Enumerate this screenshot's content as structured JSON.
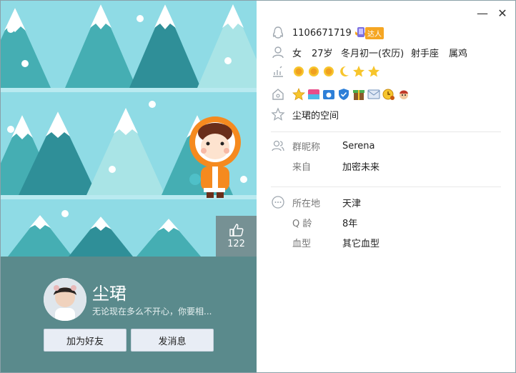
{
  "profile": {
    "qq_number": "1106671719",
    "gender": "女",
    "age": "27岁",
    "birthday": "冬月初一(农历)",
    "constellation": "射手座",
    "zodiac": "属鸡",
    "badge_label": "达人",
    "space_link": "尘珺的空间",
    "nickname": "尘珺",
    "signature": "无论现在多么不开心，你要相..."
  },
  "group_info": {
    "nick_label": "群昵称",
    "nick_value": "Serena",
    "from_label": "来自",
    "from_value": "加密未来"
  },
  "location_info": {
    "location_label": "所在地",
    "location_value": "天津",
    "qage_label": "Q 龄",
    "qage_value": "8年",
    "blood_label": "血型",
    "blood_value": "其它血型"
  },
  "actions": {
    "add_friend": "加为好友",
    "send_message": "发消息",
    "like_count": "122"
  },
  "window": {
    "minimize": "—",
    "close": "✕"
  },
  "colors": {
    "sky": "#8fdbe5",
    "tree_dark": "#2f8f98",
    "tree_mid": "#45aeb3",
    "tree_light": "#a9e4e6",
    "panel": "#5a8a8c",
    "badge_orange": "#f5a623"
  },
  "icons": {
    "level": [
      "sun-icon",
      "sun-icon",
      "sun-icon",
      "moon-icon",
      "star-icon",
      "star-icon"
    ],
    "services": [
      "yellow-star-icon",
      "app-icon",
      "camera-icon",
      "shield-icon",
      "gift-icon",
      "mail-icon",
      "clock-icon",
      "character-icon"
    ]
  }
}
